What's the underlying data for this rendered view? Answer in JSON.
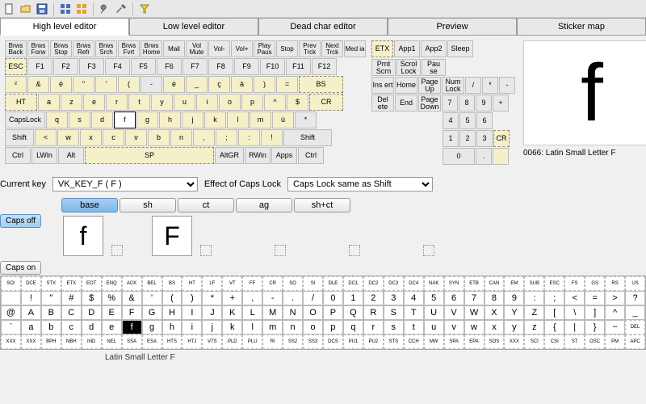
{
  "toolbar": {
    "icons": [
      "new",
      "open",
      "save",
      "print",
      "test",
      "undo",
      "redo",
      "settings",
      "filter"
    ]
  },
  "tabs": [
    {
      "label": "High level editor",
      "active": true
    },
    {
      "label": "Low level editor",
      "active": false
    },
    {
      "label": "Dead char editor",
      "active": false
    },
    {
      "label": "Preview",
      "active": false
    },
    {
      "label": "Sticker map",
      "active": false
    }
  ],
  "keyboard": {
    "row0": [
      "Brws Back",
      "Brws Forw",
      "Brws Stop",
      "Brws Refr",
      "Brws Srch",
      "Brws Fvrt",
      "Brws Home",
      "Mail",
      "Vol Mute",
      "Vol-",
      "Vol+",
      "Play Paus",
      "Stop",
      "Prev Trck",
      "Next Trck",
      "Med ia"
    ],
    "row0b": [
      "ETX",
      "App1",
      "App2",
      "Sleep"
    ],
    "row1": [
      "ESC",
      "F1",
      "F2",
      "F3",
      "F4",
      "F5",
      "F6",
      "F7",
      "F8",
      "F9",
      "F10",
      "F11",
      "F12"
    ],
    "row1b": [
      "Prnt Scrn",
      "Scrol Lock",
      "Pau se"
    ],
    "row2": [
      "²",
      "&",
      "é",
      "\"",
      "'",
      "(",
      "-",
      "è",
      "_",
      "ç",
      "à",
      ")",
      "=",
      "BS"
    ],
    "row2b": [
      "Ins ert",
      "Home",
      "Page Up",
      "Num Lock",
      "/",
      "*",
      "-"
    ],
    "row3": [
      "HT",
      "a",
      "z",
      "e",
      "r",
      "t",
      "y",
      "u",
      "i",
      "o",
      "p",
      "^",
      "$",
      "CR"
    ],
    "row3b": [
      "Del ete",
      "End",
      "Page Down",
      "7",
      "8",
      "9",
      "+"
    ],
    "row4": [
      "CapsLock",
      "q",
      "s",
      "d",
      "f",
      "g",
      "h",
      "j",
      "k",
      "l",
      "m",
      "ù",
      "*"
    ],
    "row4b": [
      "4",
      "5",
      "6"
    ],
    "row5": [
      "Shift",
      "<",
      "w",
      "x",
      "c",
      "v",
      "b",
      "n",
      ",",
      ";",
      ":",
      "!",
      "Shift"
    ],
    "row5b": [
      "1",
      "2",
      "3",
      "CR"
    ],
    "row6": [
      "Ctrl",
      "LWin",
      "Alt",
      "SP",
      "AltGR",
      "RWin",
      "Apps",
      "Ctrl"
    ],
    "row6b": [
      "0",
      ".",
      ""
    ]
  },
  "preview": {
    "char": "f",
    "label": "0066: Latin Small Letter F"
  },
  "current_key": {
    "label": "Current key",
    "value": "VK_KEY_F ( F )"
  },
  "caps_effect": {
    "label": "Effect of Caps Lock",
    "value": "Caps Lock same as Shift"
  },
  "modifiers": [
    {
      "label": "base",
      "active": true
    },
    {
      "label": "sh",
      "active": false
    },
    {
      "label": "ct",
      "active": false
    },
    {
      "label": "ag",
      "active": false
    },
    {
      "label": "sh+ct",
      "active": false
    }
  ],
  "caps_off": {
    "label": "Caps off",
    "chars": [
      "f",
      "F"
    ]
  },
  "caps_on": {
    "label": "Caps on"
  },
  "char_grid": {
    "row0": [
      "SO!",
      "DCE",
      "STX",
      "ETX",
      "EOT",
      "ENQ",
      "ACK",
      "BEL",
      "BS",
      "HT",
      "LF",
      "VT",
      "FF",
      "CR",
      "SO",
      "SI",
      "DLE",
      "DC1",
      "DC2",
      "DC3",
      "DC4",
      "NAK",
      "SYN",
      "ETB",
      "CAN",
      "EM",
      "SUB",
      "ESC",
      "FS",
      "GS",
      "RS",
      "US"
    ],
    "row1": [
      " ",
      "!",
      "\"",
      "#",
      "$",
      "%",
      "&",
      "'",
      "(",
      ")",
      "*",
      "+",
      ",",
      "-",
      ".",
      "/",
      "0",
      "1",
      "2",
      "3",
      "4",
      "5",
      "6",
      "7",
      "8",
      "9",
      ":",
      ";",
      "<",
      "=",
      ">",
      "?"
    ],
    "row2": [
      "@",
      "A",
      "B",
      "C",
      "D",
      "E",
      "F",
      "G",
      "H",
      "I",
      "J",
      "K",
      "L",
      "M",
      "N",
      "O",
      "P",
      "Q",
      "R",
      "S",
      "T",
      "U",
      "V",
      "W",
      "X",
      "Y",
      "Z",
      "[",
      "\\",
      "]",
      "^",
      "_"
    ],
    "row3": [
      "`",
      "a",
      "b",
      "c",
      "d",
      "e",
      "f",
      "g",
      "h",
      "i",
      "j",
      "k",
      "l",
      "m",
      "n",
      "o",
      "p",
      "q",
      "r",
      "s",
      "t",
      "u",
      "v",
      "w",
      "x",
      "y",
      "z",
      "{",
      "|",
      "}",
      "~",
      "DEL"
    ],
    "row4": [
      "XXX",
      "XXX",
      "BPH",
      "NBH",
      "IND",
      "NEL",
      "SSA",
      "ESA",
      "HTS",
      "HTJ",
      "VTS",
      "PLD",
      "PLU",
      "RI",
      "SS2",
      "SS3",
      "DCS",
      "PU1",
      "PU2",
      "STS",
      "CCH",
      "MW",
      "SPA",
      "EPA",
      "SOS",
      "XXX",
      "SCI",
      "CSI",
      "ST",
      "OSC",
      "PM",
      "APC"
    ]
  },
  "footer": {
    "label": "Latin Small Letter F"
  }
}
